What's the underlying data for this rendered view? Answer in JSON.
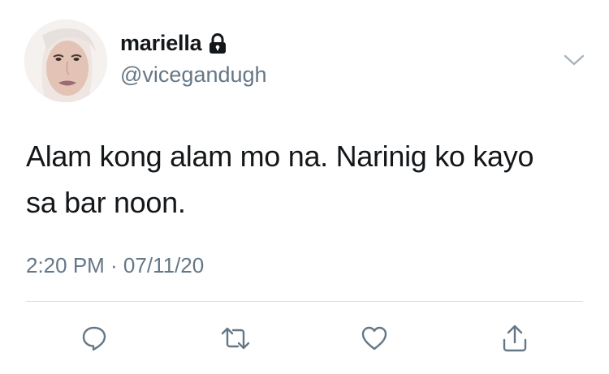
{
  "user": {
    "display_name": "mariella",
    "handle": "@vicegandugh",
    "protected": true,
    "avatar_icon": "profile-photo"
  },
  "tweet": {
    "text_line1": "Alam kong alam mo na. Narinig ko kayo",
    "text_line2": "sa bar noon.",
    "timestamp": "2:20 PM · 07/11/20"
  },
  "actions": [
    {
      "name": "reply",
      "icon": "speech-bubble-icon"
    },
    {
      "name": "retweet",
      "icon": "retweet-arrows-icon"
    },
    {
      "name": "like",
      "icon": "heart-icon"
    },
    {
      "name": "share",
      "icon": "share-upload-icon"
    }
  ],
  "colors": {
    "text": "#14171a",
    "secondary": "#657786",
    "divider": "#d9dfe3",
    "icon": "#657786"
  }
}
